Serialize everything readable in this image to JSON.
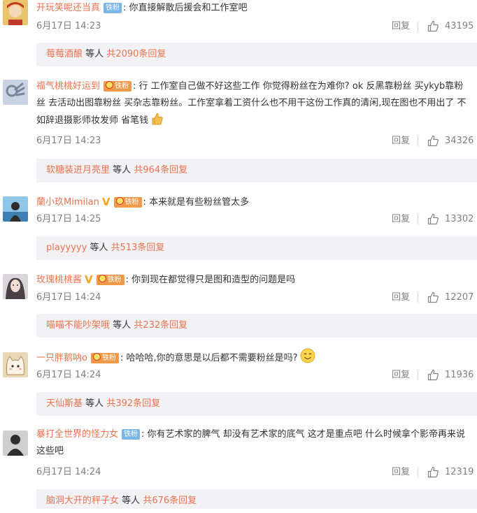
{
  "comments": [
    {
      "username": "开玩笑呢还当真",
      "badge": "铁粉",
      "colon": ":",
      "text": "你直接解散后援会和工作室吧",
      "time": "6月17日 14:23",
      "reply_label": "回复",
      "likes": "43195",
      "sub": {
        "names": "莓莓酒酿",
        "mid": "等人",
        "total": "共2090条回复"
      }
    },
    {
      "username": "福气桃桃好运到",
      "badge": "铁粉",
      "colon": ":",
      "text": "行 工作室自己做不好这些工作 你觉得粉丝在为难你? ok 反黑靠粉丝 买ykyb靠粉丝 去活动出图靠粉丝 买杂志靠粉丝。工作室拿着工资什么也不用干这份工作真的清闲,现在图也不用出了 不如辞退摄影师妆发师 省笔钱",
      "time": "6月17日 14:23",
      "reply_label": "回复",
      "likes": "34326",
      "sub": {
        "names": "软糖装进月亮里",
        "mid": "等人",
        "total": "共964条回复"
      }
    },
    {
      "username": "蘭小玖Mimilan",
      "badge": "铁粉",
      "colon": ":",
      "text": "本来就是有些粉丝管太多",
      "time": "6月17日 14:25",
      "reply_label": "回复",
      "likes": "13302",
      "sub": {
        "names": "playyyyy",
        "mid": "等人",
        "total": "共513条回复"
      }
    },
    {
      "username": "玫瑰桃桃酱",
      "badge": "铁粉",
      "colon": ":",
      "text": "你到现在都觉得只是图和造型的问题是吗",
      "time": "6月17日 14:24",
      "reply_label": "回复",
      "likes": "12207",
      "sub": {
        "names": "喵喵不能吵架哦",
        "mid": "等人",
        "total": "共232条回复"
      }
    },
    {
      "username": "一只胖鹅呐o",
      "badge": "铁粉",
      "colon": ":",
      "text": "哈哈哈,你的意思是以后都不需要粉丝是吗?",
      "time": "6月17日 14:24",
      "reply_label": "回复",
      "likes": "11936",
      "sub": {
        "names": "天仙斯基",
        "mid": "等人",
        "total": "共392条回复"
      }
    },
    {
      "username": "暴打全世界的怪力女",
      "badge": "铁粉",
      "colon": ":",
      "text": "你有艺术家的脾气 却没有艺术家的底气 这才是重点吧 什么时候拿个影帝再来说这些吧",
      "time": "6月17日 14:24",
      "reply_label": "回复",
      "likes": "12319",
      "sub": {
        "names": "脑洞大开的秤子女",
        "mid": "等人",
        "total": "共676条回复"
      }
    }
  ],
  "colors": {
    "username": "#eb7350",
    "meta": "#808080",
    "sub_bg": "#f2f2f5",
    "badge_iron": "#7ab7e8",
    "badge_fan": "#f09a49"
  },
  "icons": {
    "like": "thumbs-up-icon",
    "vip": "vip-v-icon",
    "thumb_emoji": "thumbs-up-emoji",
    "smile_emoji": "smile-emoji"
  }
}
